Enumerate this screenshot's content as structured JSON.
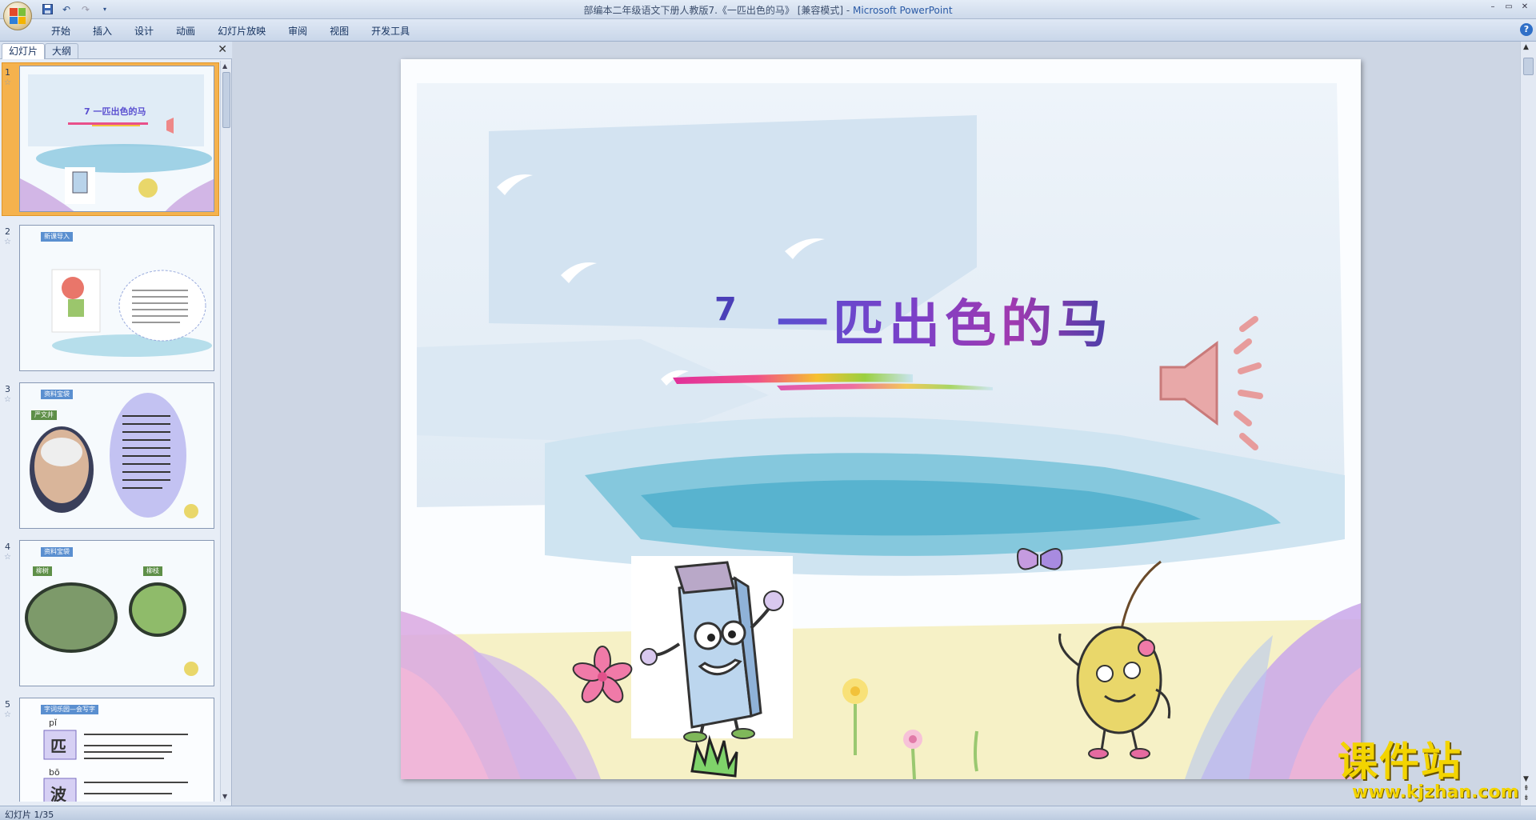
{
  "window": {
    "title_doc": "部编本二年级语文下册人教版7.《一匹出色的马》 [兼容模式] - ",
    "title_app": "Microsoft PowerPoint",
    "controls": [
      "–",
      "▭",
      "✕"
    ]
  },
  "ribbon": {
    "tabs": [
      "开始",
      "插入",
      "设计",
      "动画",
      "幻灯片放映",
      "审阅",
      "视图",
      "开发工具"
    ],
    "help": "?"
  },
  "panel": {
    "tabs": [
      "幻灯片",
      "大纲"
    ],
    "close": "✕",
    "thumbnails": [
      {
        "num": "1",
        "label": "7 一匹出色的马"
      },
      {
        "num": "2",
        "label": "新课导入"
      },
      {
        "num": "3",
        "label": "资料宝袋"
      },
      {
        "num": "4",
        "label": "资料宝袋"
      },
      {
        "num": "5",
        "label": "字词乐园—会写字"
      }
    ],
    "thumb_extra": {
      "t3_name": "严文井",
      "t4_left": "柳树",
      "t4_right": "柳枝",
      "t5_pinyin1": "pǐ",
      "t5_char1": "匹",
      "t5_pinyin2": "bō",
      "t5_char2": "波"
    }
  },
  "slide": {
    "number": "7",
    "title": "一匹出色的马"
  },
  "status": {
    "text": "幻灯片 1/35"
  },
  "watermark": {
    "big": "课件站",
    "small": "www.kjzhan.com"
  }
}
